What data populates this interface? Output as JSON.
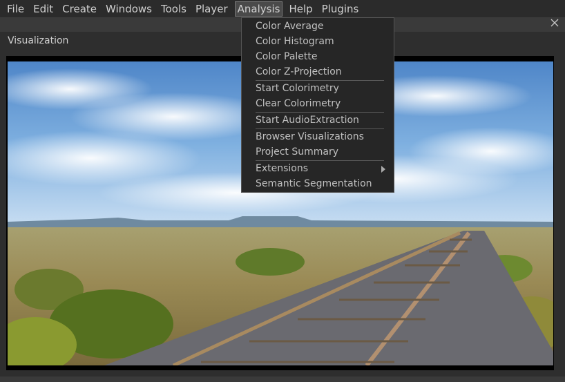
{
  "menubar": {
    "items": [
      "File",
      "Edit",
      "Create",
      "Windows",
      "Tools",
      "Player",
      "Analysis",
      "Help",
      "Plugins"
    ]
  },
  "panel": {
    "title": "Visualization"
  },
  "analysis_menu": {
    "items": [
      "Color Average",
      "Color Histogram",
      "Color Palette",
      "Color Z-Projection",
      "Start Colorimetry",
      "Clear Colorimetry",
      "Start AudioExtraction",
      "Browser Visualizations",
      "Project Summary",
      "Extensions",
      "Semantic Segmentation"
    ]
  },
  "colors": {
    "menubar_bg": "#2b2b2b",
    "panel_bg": "#2e2e2e",
    "menu_bg": "#262626",
    "text": "#c8c8c8"
  }
}
